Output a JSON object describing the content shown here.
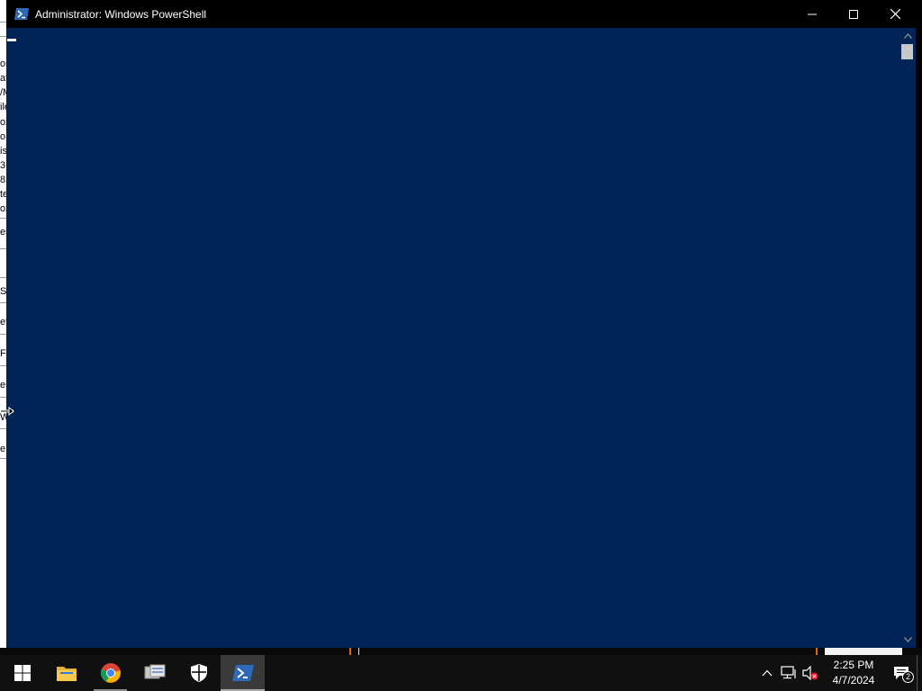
{
  "window": {
    "title": "Administrator: Windows PowerShell",
    "console_bg": "#012456"
  },
  "background_window": {
    "fragments": [
      "on",
      "at",
      "/M",
      "ile",
      "ox",
      "o",
      "is",
      "3",
      "8",
      "te",
      "ox",
      "es",
      "Se",
      "et",
      "F",
      "er",
      "W",
      "e"
    ]
  },
  "taskbar": {
    "items": [
      {
        "name": "start",
        "icon": "windows-logo-icon"
      },
      {
        "name": "file-explorer",
        "icon": "folder-icon"
      },
      {
        "name": "chrome",
        "icon": "chrome-icon"
      },
      {
        "name": "server-manager",
        "icon": "server-manager-icon"
      },
      {
        "name": "windows-security",
        "icon": "shield-icon"
      },
      {
        "name": "powershell",
        "icon": "powershell-icon"
      }
    ],
    "tray_icons": [
      "chevron-up-icon",
      "network-icon",
      "volume-muted-icon"
    ],
    "clock": {
      "time": "2:25 PM",
      "date": "4/7/2024"
    },
    "notifications": {
      "count": "2"
    }
  }
}
